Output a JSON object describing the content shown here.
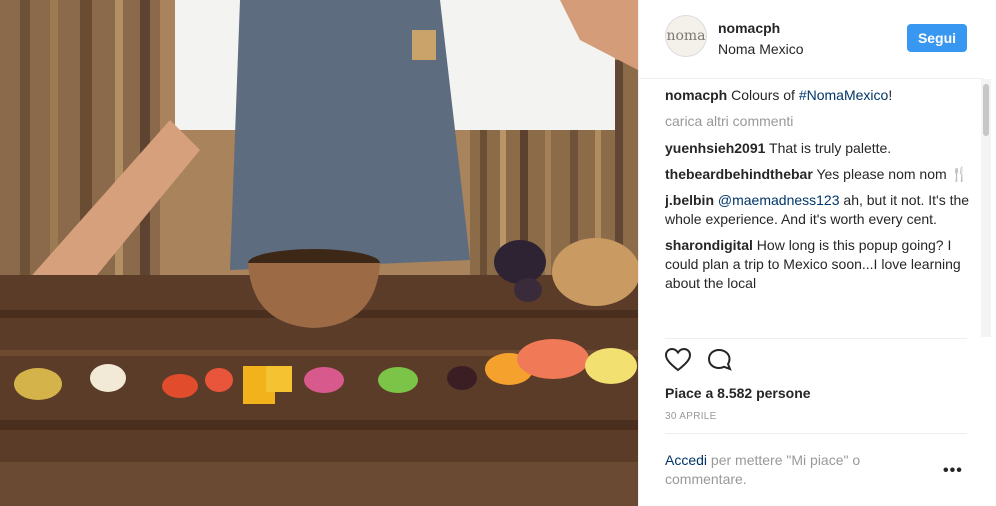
{
  "post": {
    "username": "nomacph",
    "location": "Noma Mexico",
    "avatar_text": "noma",
    "follow_label": "Segui"
  },
  "caption": {
    "username": "nomacph",
    "text": "Colours of ",
    "hashtag": "#NomaMexico",
    "text_end": "!"
  },
  "load_more_label": "carica altri commenti",
  "comments": [
    {
      "username": "yuenhsieh2091",
      "text": "That is truly palette."
    },
    {
      "username": "thebeardbehindthebar",
      "text": "Yes please nom nom 🍴"
    },
    {
      "username": "j.belbin",
      "mention": "@maemadness123",
      "text": " ah, but it not. It's the whole experience. And it's worth every cent."
    },
    {
      "username": "sharondigital",
      "text": "How long is this popup going? I could plan a trip to Mexico soon...I love learning about the local"
    }
  ],
  "icons": [
    "heart-icon",
    "comment-icon",
    "more-options-icon"
  ],
  "likes_text": "Piace a 8.582 persone",
  "date_text": "30 APRILE",
  "login_prompt": {
    "link": "Accedi",
    "text": " per mettere \"Mi piace\" o commentare."
  },
  "more_dots": "•••"
}
